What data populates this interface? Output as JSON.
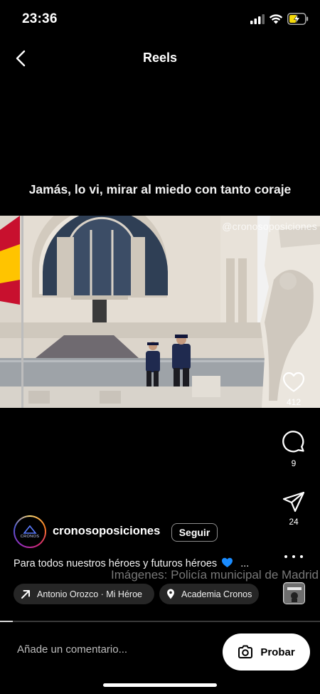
{
  "status_bar": {
    "time": "23:36"
  },
  "header": {
    "title": "Reels"
  },
  "video": {
    "caption": "Jamás, lo vi, mirar al miedo con tanto coraje",
    "watermark": "@cronosoposiciones"
  },
  "actions": {
    "likes": "412",
    "comments": "9",
    "shares": "24"
  },
  "author": {
    "username": "cronosoposiciones",
    "avatar_text": "CRONOS",
    "follow_label": "Seguir"
  },
  "description": {
    "text": "Para todos nuestros héroes y futuros héroes",
    "emoji": "💙",
    "ellipsis": "...",
    "overlay_watermark": "Imágenes: Policía municipal de Madrid"
  },
  "chips": {
    "audio": "Antonio Orozco · Mi Héroe",
    "location": "Academia Cronos"
  },
  "progress": {
    "fraction": 0.04
  },
  "bottom_bar": {
    "comment_placeholder": "Añade un comentario...",
    "try_label": "Probar"
  },
  "colors": {
    "background": "#000000",
    "chip_bg": "#262626",
    "heart_emoji": "#1a8cff",
    "battery_charging": "#f5d90a"
  },
  "icons": [
    "signal-icon",
    "wifi-icon",
    "battery-icon",
    "back-arrow-icon",
    "heart-icon",
    "comment-icon",
    "share-icon",
    "more-icon",
    "arrow-up-right-icon",
    "location-pin-icon",
    "camera-icon"
  ]
}
